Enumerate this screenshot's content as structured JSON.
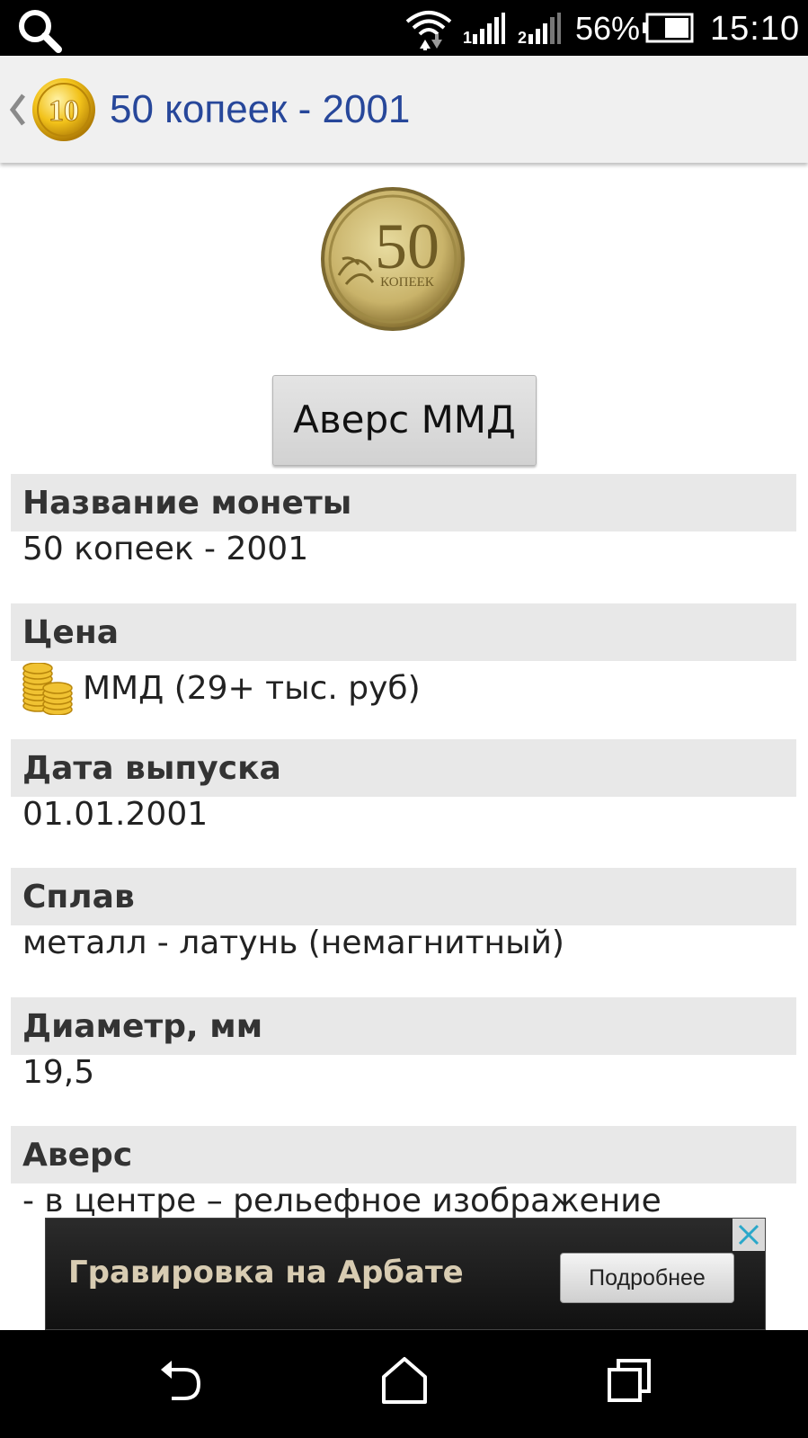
{
  "status_bar": {
    "battery_percent": "56%",
    "time": "15:10",
    "icons": [
      "search-icon",
      "wifi-icon",
      "signal-1-icon",
      "signal-2-icon",
      "battery-icon"
    ]
  },
  "action_bar": {
    "title": "50 копеек - 2001",
    "app_icon_label": "10"
  },
  "coin": {
    "value_label": "50",
    "unit_label": "КОПЕЕК"
  },
  "averse_button_label": "Аверс ММД",
  "sections": [
    {
      "header": "Название монеты",
      "value": "50 копеек - 2001"
    },
    {
      "header": "Цена",
      "value": "ММД (29+ тыс. руб)"
    },
    {
      "header": "Дата выпуска",
      "value": "01.01.2001"
    },
    {
      "header": "Сплав",
      "value": "металл - латунь (немагнитный)"
    },
    {
      "header": "Диаметр, мм",
      "value": "19,5"
    },
    {
      "header": "Аверс",
      "value": "- в центре – рельефное изображение"
    }
  ],
  "ad": {
    "text": "Гравировка на Арбате",
    "button_label": "Подробнее"
  },
  "nav_bar": {
    "icons": [
      "back-icon",
      "home-icon",
      "recent-apps-icon"
    ]
  }
}
